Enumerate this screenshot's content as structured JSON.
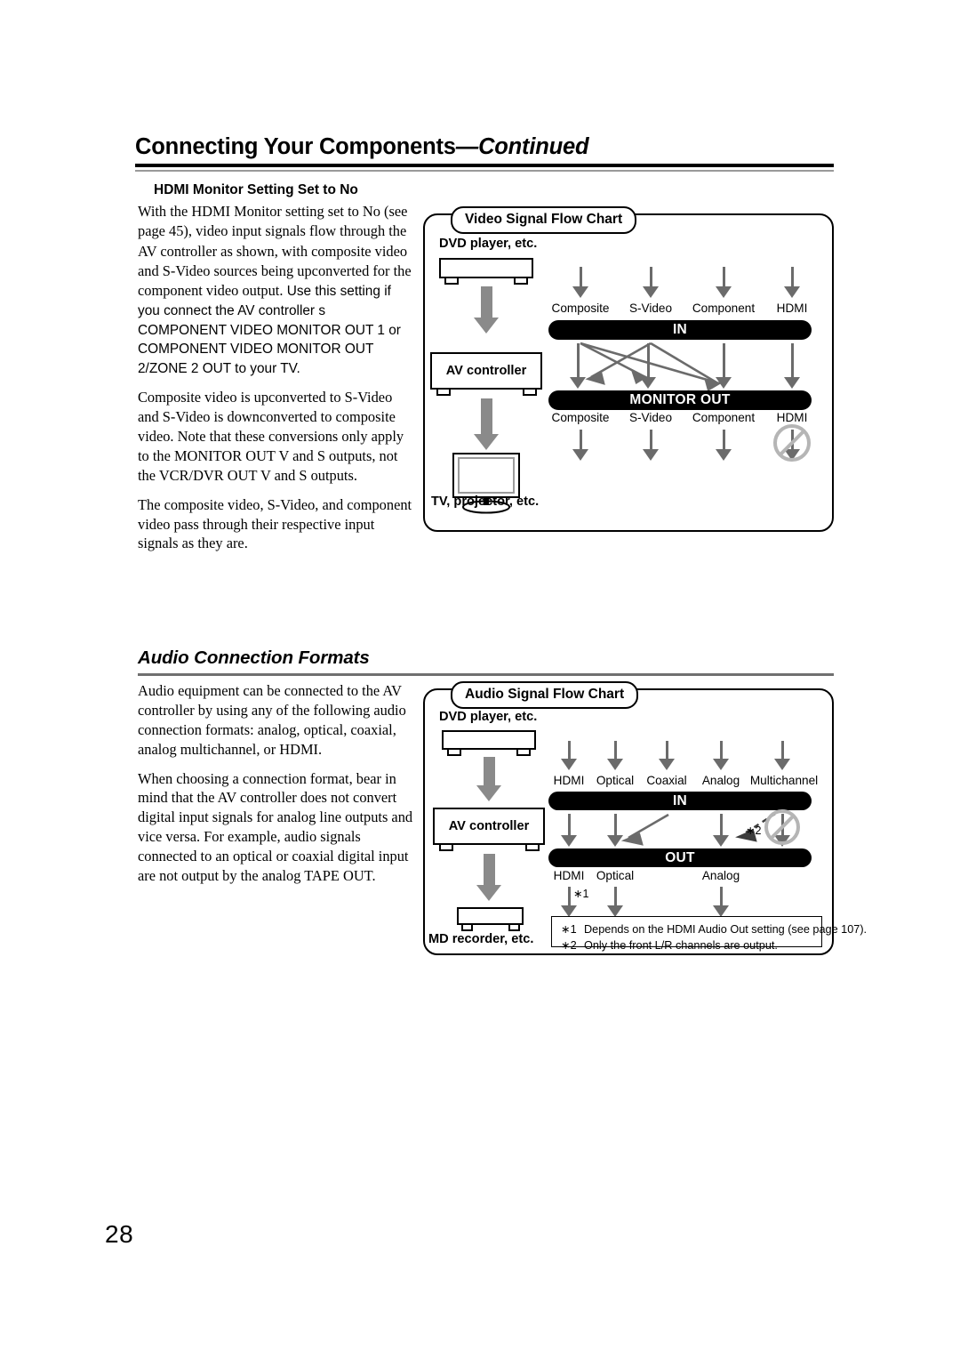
{
  "page": {
    "number": "28",
    "running_head": "Connecting Your Components",
    "running_head_continued": "—Continued"
  },
  "video_section": {
    "sub_head": "HDMI Monitor Setting Set to No",
    "para1_serif": "With the HDMI Monitor setting set to No (see page 45), video input signals flow through the AV controller as shown, with composite video and S-Video sources being upconverted for the component video output.",
    "para1_sans": " Use this setting if you connect the AV controller s COMPONENT VIDEO MONITOR OUT 1 or COMPONENT VIDEO MONITOR OUT 2/ZONE 2 OUT to your TV.",
    "para2": "Composite video is upconverted to S-Video and S-Video is downconverted to composite video. Note that these conversions only apply to the MONITOR OUT V and S outputs, not the VCR/DVR OUT V and S outputs.",
    "para3": "The composite video, S-Video, and component video pass through their respective input signals as they are."
  },
  "audio_section": {
    "heading": "Audio Connection Formats",
    "para1": "Audio equipment can be connected to the AV controller by using any of the following audio connection formats: analog, optical, coaxial, analog multichannel, or HDMI.",
    "para2": "When choosing a connection format, bear in mind that the AV controller does not convert digital input signals for analog line outputs and vice versa. For example, audio signals connected to an optical or coaxial digital input are not output by the analog TAPE OUT."
  },
  "video_chart": {
    "legend": "Video Signal Flow Chart",
    "source_label": "DVD player, etc.",
    "controller_label": "AV controller",
    "sink_label": "TV, projector, etc.",
    "in_bar": "IN",
    "out_bar": "MONITOR OUT",
    "in_ports": [
      "Composite",
      "S-Video",
      "Component",
      "HDMI"
    ],
    "out_ports": [
      "Composite",
      "S-Video",
      "Component",
      "HDMI"
    ],
    "blocked_output": "HDMI"
  },
  "audio_chart": {
    "legend": "Audio Signal Flow Chart",
    "source_label": "DVD player, etc.",
    "controller_label": "AV controller",
    "sink_label": "MD recorder, etc.",
    "in_bar": "IN",
    "out_bar": "OUT",
    "in_ports": [
      "HDMI",
      "Optical",
      "Coaxial",
      "Analog",
      "Multichannel"
    ],
    "out_ports": [
      "HDMI",
      "Optical",
      "Analog"
    ],
    "blocked_output": "Multichannel",
    "marker_1": "∗1",
    "marker_2": "∗2",
    "footnotes": [
      {
        "mark": "∗1",
        "text": "Depends on the HDMI Audio Out setting (see page 107)."
      },
      {
        "mark": "∗2",
        "text": "Only the front L/R channels are output."
      }
    ]
  }
}
